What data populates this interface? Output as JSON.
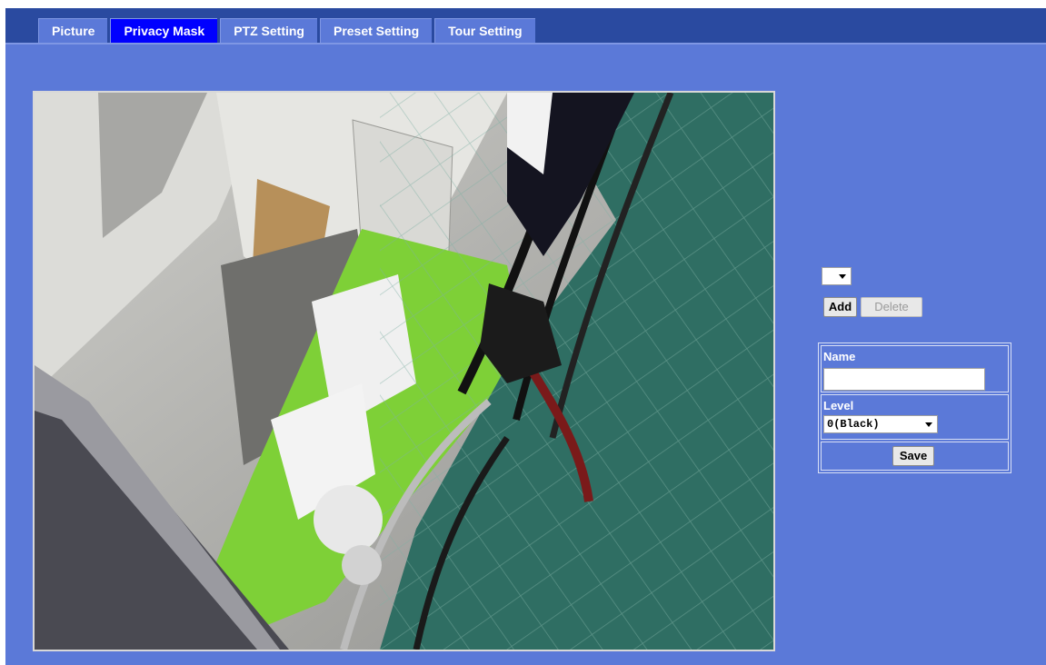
{
  "tabs": [
    {
      "label": "Picture",
      "active": false
    },
    {
      "label": "Privacy Mask",
      "active": true
    },
    {
      "label": "PTZ Setting",
      "active": false
    },
    {
      "label": "Preset Setting",
      "active": false
    },
    {
      "label": "Tour Setting",
      "active": false
    }
  ],
  "mask_list": {
    "selected": ""
  },
  "buttons": {
    "add": "Add",
    "delete": "Delete",
    "save": "Save"
  },
  "form": {
    "name_label": "Name",
    "name_value": "",
    "level_label": "Level",
    "level_value": "0(Black)"
  },
  "colors": {
    "page_background": "#5b79d8",
    "header_background": "#2a4aa0",
    "active_tab": "#0000ff",
    "inactive_tab": "#5b79d8"
  }
}
